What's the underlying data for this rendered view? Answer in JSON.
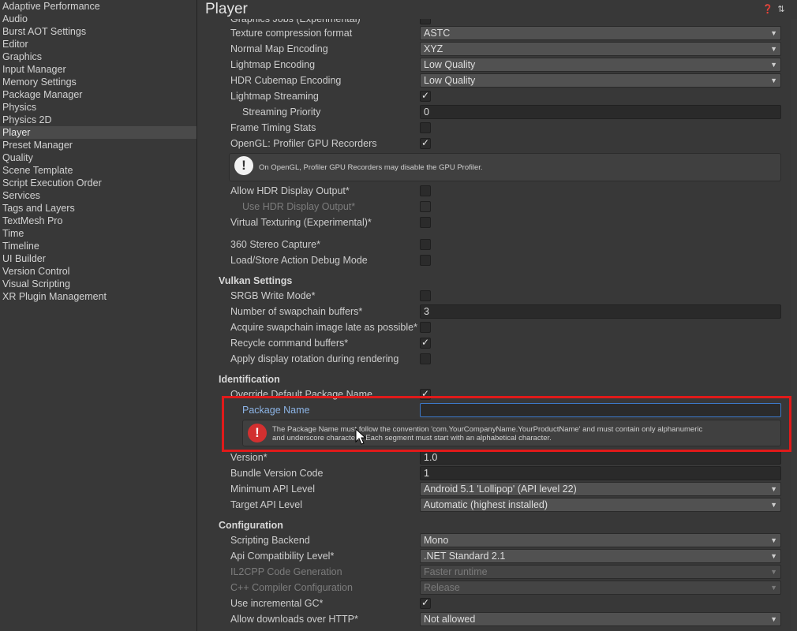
{
  "sidebar": {
    "items": [
      "Adaptive Performance",
      "Audio",
      "Burst AOT Settings",
      "Editor",
      "Graphics",
      "Input Manager",
      "Memory Settings",
      "Package Manager",
      "Physics",
      "Physics 2D",
      "Player",
      "Preset Manager",
      "Quality",
      "Scene Template",
      "Script Execution Order",
      "Services",
      "Tags and Layers",
      "TextMesh Pro",
      "Time",
      "Timeline",
      "UI Builder",
      "Version Control",
      "Visual Scripting",
      "XR Plugin Management"
    ],
    "selected": "Player"
  },
  "header": {
    "title": "Player",
    "help_icon": "help-icon",
    "settings_icon": "sliders-icon"
  },
  "rows": {
    "graphics_jobs": {
      "label": "Graphics Jobs (Experimental)"
    },
    "texture_compression": {
      "label": "Texture compression format",
      "value": "ASTC"
    },
    "normal_map": {
      "label": "Normal Map Encoding",
      "value": "XYZ"
    },
    "lightmap_encoding": {
      "label": "Lightmap Encoding",
      "value": "Low Quality"
    },
    "hdr_cubemap": {
      "label": "HDR Cubemap Encoding",
      "value": "Low Quality"
    },
    "lightmap_streaming": {
      "label": "Lightmap Streaming",
      "checked": true
    },
    "streaming_priority": {
      "label": "Streaming Priority",
      "value": "0"
    },
    "frame_timing": {
      "label": "Frame Timing Stats",
      "checked": false
    },
    "opengl_profiler": {
      "label": "OpenGL: Profiler GPU Recorders",
      "checked": true
    },
    "opengl_help": "On OpenGL, Profiler GPU Recorders may disable the GPU Profiler.",
    "allow_hdr": {
      "label": "Allow HDR Display Output*",
      "checked": false
    },
    "use_hdr": {
      "label": "Use HDR Display Output*",
      "checked": false
    },
    "virtual_texturing": {
      "label": "Virtual Texturing (Experimental)*",
      "checked": false
    },
    "stereo_capture": {
      "label": "360 Stereo Capture*",
      "checked": false
    },
    "load_store": {
      "label": "Load/Store Action Debug Mode",
      "checked": false
    }
  },
  "vulkan": {
    "section": "Vulkan Settings",
    "srgb": {
      "label": "SRGB Write Mode*",
      "checked": false
    },
    "swapchain": {
      "label": "Number of swapchain buffers*",
      "value": "3"
    },
    "acquire": {
      "label": "Acquire swapchain image late as possible*",
      "checked": false
    },
    "recycle": {
      "label": "Recycle command buffers*",
      "checked": true
    },
    "rotation": {
      "label": "Apply display rotation during rendering",
      "checked": false
    }
  },
  "identification": {
    "section": "Identification",
    "override": {
      "label": "Override Default Package Name",
      "checked": true
    },
    "package_name": {
      "label": "Package Name",
      "value": ""
    },
    "error": "The Package Name must follow the convention 'com.YourCompanyName.YourProductName' and must contain only alphanumeric and underscore characters. Each segment must start with an alphabetical character.",
    "error_line1": "The Package Name must follow the convention 'com.YourCompanyName.YourProductName' and must contain only alphanumeric",
    "error_line2": "and underscore characters. Each segment must start with an alphabetical character.",
    "version": {
      "label": "Version*",
      "value": "1.0"
    },
    "bundle_code": {
      "label": "Bundle Version Code",
      "value": "1"
    },
    "min_api": {
      "label": "Minimum API Level",
      "value": "Android 5.1 'Lollipop' (API level 22)"
    },
    "target_api": {
      "label": "Target API Level",
      "value": "Automatic (highest installed)"
    }
  },
  "configuration": {
    "section": "Configuration",
    "scripting_backend": {
      "label": "Scripting Backend",
      "value": "Mono"
    },
    "api_compat": {
      "label": "Api Compatibility Level*",
      "value": ".NET Standard 2.1"
    },
    "il2cpp": {
      "label": "IL2CPP Code Generation",
      "value": "Faster runtime"
    },
    "cpp_compiler": {
      "label": "C++ Compiler Configuration",
      "value": "Release"
    },
    "incremental_gc": {
      "label": "Use incremental GC*",
      "checked": true
    },
    "http": {
      "label": "Allow downloads over HTTP*",
      "value": "Not allowed"
    }
  },
  "colors": {
    "background": "#383838",
    "highlight_border": "#e01a1a",
    "focus_border": "#3d79c9",
    "error_icon": "#d23030"
  }
}
